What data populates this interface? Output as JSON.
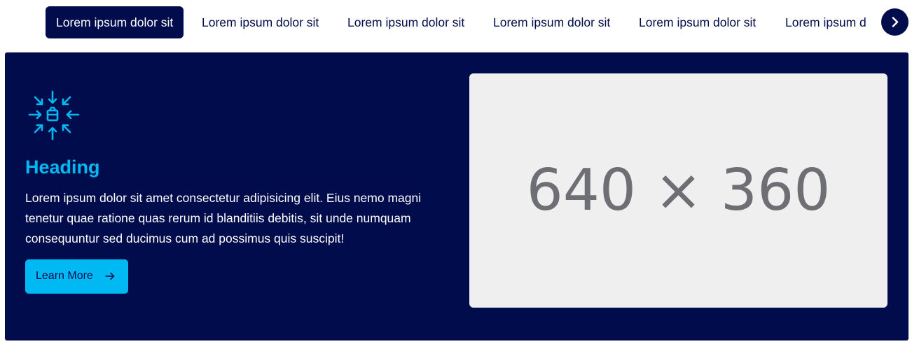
{
  "tabs": [
    {
      "label": "Lorem ipsum dolor sit",
      "active": true
    },
    {
      "label": "Lorem ipsum dolor sit",
      "active": false
    },
    {
      "label": "Lorem ipsum dolor sit",
      "active": false
    },
    {
      "label": "Lorem ipsum dolor sit",
      "active": false
    },
    {
      "label": "Lorem ipsum dolor sit",
      "active": false
    },
    {
      "label": "Lorem ipsum d",
      "active": false
    }
  ],
  "next_button": {
    "icon": "chevron-right-icon"
  },
  "feature": {
    "icon": "arrows-inward-box-icon",
    "heading": "Heading",
    "body": "Lorem ipsum dolor sit amet consectetur adipisicing elit. Eius nemo magni tenetur quae ratione quas rerum id blanditiis debitis, sit unde numquam consequuntur sed ducimus cum ad possimus quis suscipit!",
    "cta_label": "Learn More",
    "cta_icon": "arrow-right-icon",
    "image_placeholder": "640 × 360"
  },
  "colors": {
    "navy": "#000c4b",
    "accent": "#00b9f2",
    "placeholder_bg": "#efefef",
    "placeholder_text": "#6e6e75"
  }
}
